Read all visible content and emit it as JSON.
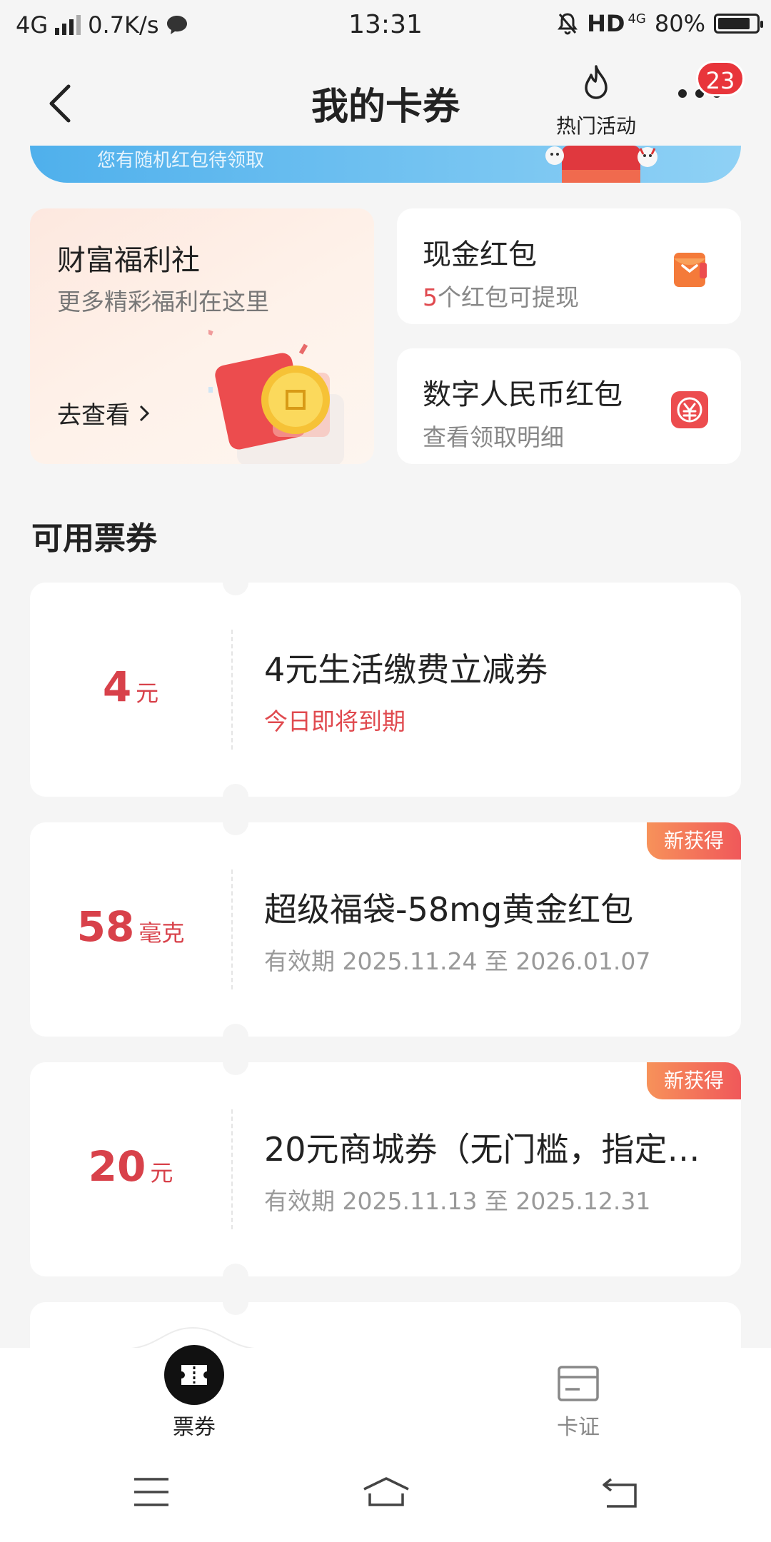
{
  "status_bar": {
    "network": "4G",
    "speed": "0.7K/s",
    "time": "13:31",
    "hd": "HD",
    "hd_network": "4G",
    "battery": "80%"
  },
  "header": {
    "title": "我的卡券",
    "hot_activity_label": "热门活动",
    "notification_count": "23"
  },
  "banner": {
    "text": "您有随机红包待领取"
  },
  "welfare_card": {
    "title": "财富福利社",
    "subtitle": "更多精彩福利在这里",
    "link": "去查看"
  },
  "cash_redpacket": {
    "title": "现金红包",
    "count": "5",
    "subtitle_suffix": "个红包可提现"
  },
  "ecny_redpacket": {
    "title": "数字人民币红包",
    "subtitle": "查看领取明细"
  },
  "section": {
    "title": "可用票券"
  },
  "coupons": [
    {
      "amount": "4",
      "unit": "元",
      "title": "4元生活缴费立减券",
      "subtitle": "今日即将到期",
      "tag": ""
    },
    {
      "amount": "58",
      "unit": "毫克",
      "title": "超级福袋-58mg黄金红包",
      "subtitle": "有效期 2025.11.24 至 2026.01.07",
      "tag": "新获得"
    },
    {
      "amount": "20",
      "unit": "元",
      "title": "20元商城券（无门槛，指定…",
      "subtitle": "有效期 2025.11.13 至 2025.12.31",
      "tag": "新获得"
    }
  ],
  "bottom_nav": {
    "tickets_label": "票券",
    "cards_label": "卡证"
  },
  "colors": {
    "accent_red": "#d8414a",
    "background": "#f5f5f5",
    "tag_gradient_start": "#f7925a",
    "tag_gradient_end": "#f0585a"
  }
}
